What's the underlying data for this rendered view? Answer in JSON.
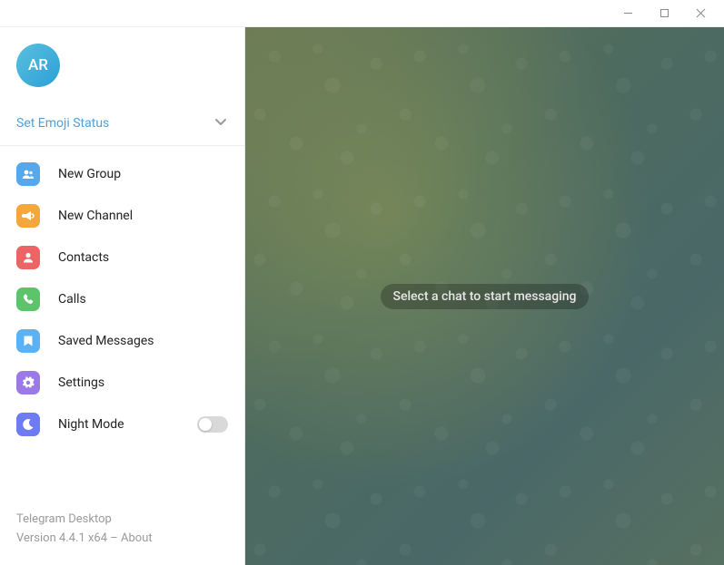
{
  "window": {
    "minimize": "—",
    "maximize": "▢",
    "close": "✕"
  },
  "profile": {
    "initials": "AR"
  },
  "status": {
    "set_emoji_label": "Set Emoji Status"
  },
  "menu": {
    "new_group": "New Group",
    "new_channel": "New Channel",
    "contacts": "Contacts",
    "calls": "Calls",
    "saved_messages": "Saved Messages",
    "settings": "Settings",
    "night_mode": "Night Mode"
  },
  "footer": {
    "app_name": "Telegram Desktop",
    "version_line_prefix": "Version 4.4.1 x64 – ",
    "about": "About"
  },
  "chat": {
    "placeholder": "Select a chat to start messaging"
  }
}
